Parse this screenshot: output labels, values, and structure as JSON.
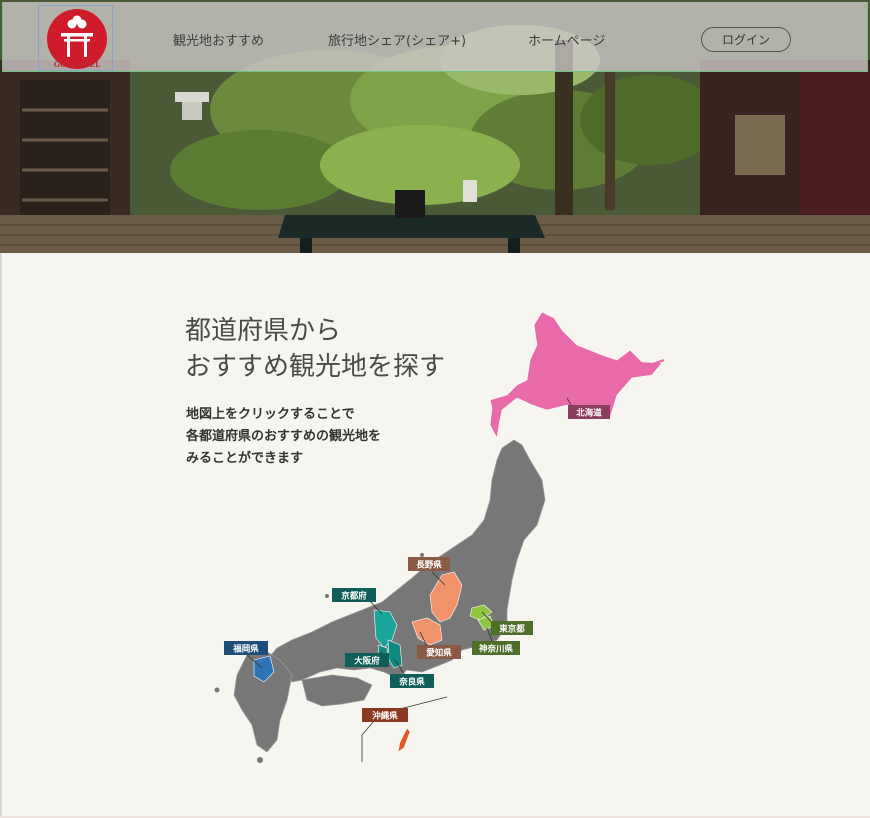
{
  "nav": {
    "logo_text": "GO TRAVEL",
    "links": [
      "観光地おすすめ",
      "旅行地シェア(シェア+)",
      "ホームページ"
    ],
    "login_label": "ログイン"
  },
  "main": {
    "title_line1": "都道府県から",
    "title_line2": "おすすめ観光地を探す",
    "desc_line1": "地図上をクリックすることで",
    "desc_line2": "各都道府県のおすすめの観光地を",
    "desc_line3": "みることができます"
  },
  "map": {
    "prefectures": [
      {
        "id": "hokkaido",
        "label": "北海道",
        "color": "#e86aa8"
      },
      {
        "id": "nagano",
        "label": "長野県",
        "color": "#f0926a"
      },
      {
        "id": "kyoto",
        "label": "京都府",
        "color": "#1aa59a"
      },
      {
        "id": "tokyo",
        "label": "東京都",
        "color": "#8ec63f"
      },
      {
        "id": "fukuoka",
        "label": "福岡県",
        "color": "#2f74b6"
      },
      {
        "id": "osaka",
        "label": "大阪府",
        "color": "#0e8a80"
      },
      {
        "id": "aichi",
        "label": "愛知県",
        "color": "#f0926a"
      },
      {
        "id": "kanagawa",
        "label": "神奈川県",
        "color": "#8ec63f"
      },
      {
        "id": "nara",
        "label": "奈良県",
        "color": "#0e8a80"
      },
      {
        "id": "okinawa",
        "label": "沖縄県",
        "color": "#e05a2b"
      }
    ],
    "base_color": "#777777"
  }
}
